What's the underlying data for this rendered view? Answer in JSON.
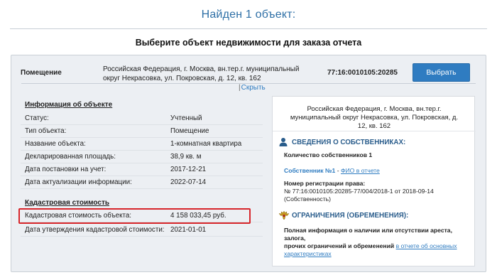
{
  "header": {
    "title": "Найден 1 объект:",
    "subtitle": "Выберите объект недвижимости для заказа отчета"
  },
  "result": {
    "object_type": "Помещение",
    "address": "Российская Федерация, г. Москва, вн.тер.г. муниципальный округ Некрасовка, ул. Покровская, д. 12, кв. 162",
    "cadastral_number": "77:16:0010105:20285",
    "select_button": "Выбрать",
    "hide_link": "Скрыть",
    "hide_prefix": "|"
  },
  "object_info": {
    "section_title": "Информация об объекте",
    "rows": [
      {
        "label": "Статус:",
        "value": "Учтенный"
      },
      {
        "label": "Тип объекта:",
        "value": "Помещение"
      },
      {
        "label": "Название объекта:",
        "value": "1-комнатная квартира"
      },
      {
        "label": "Декларированная площадь:",
        "value": "38,9 кв. м"
      },
      {
        "label": "Дата постановки на учет:",
        "value": "2017-12-21"
      },
      {
        "label": "Дата актуализации информации:",
        "value": "2022-07-14"
      }
    ]
  },
  "cadastral_value": {
    "section_title": "Кадастровая стоимость",
    "rows": [
      {
        "label": "Кадастровая стоимость объекта:",
        "value": "4 158 033,45 руб."
      },
      {
        "label": "Дата утверждения кадастровой стоимости:",
        "value": "2021-01-01"
      }
    ],
    "highlight_color": "#d7262b"
  },
  "right_panel": {
    "address": "Российская Федерация, г. Москва, вн.тер.г. муниципальный округ Некрасовка, ул. Покровская, д. 12, кв. 162",
    "owners": {
      "title": "СВЕДЕНИЯ О СОБСТВЕННИКАХ:",
      "icon": "person-icon",
      "count_text": "Количество собственников 1",
      "owner_label": "Собственник №1",
      "owner_sep": " - ",
      "owner_link": "ФИО в отчете",
      "reg_title": "Номер регистрации права:",
      "reg_value": "№ 77:16:0010105:20285-77/004/2018-1 от 2018-09-14",
      "reg_note": "(Собственность)"
    },
    "restrictions": {
      "title": "ОГРАНИЧЕНИЯ (ОБРЕМЕНЕНИЯ):",
      "icon": "eagle-emblem-icon",
      "text_a": "Полная информация о наличии или отсутствии ареста, залога,",
      "text_b": "прочих ограничений и обременений ",
      "link_a": "в отчете об основных",
      "link_b": "характеристиках"
    }
  },
  "colors": {
    "accent": "#2f7cc1",
    "title": "#2e6fa6",
    "card_bg": "#eceff3"
  }
}
